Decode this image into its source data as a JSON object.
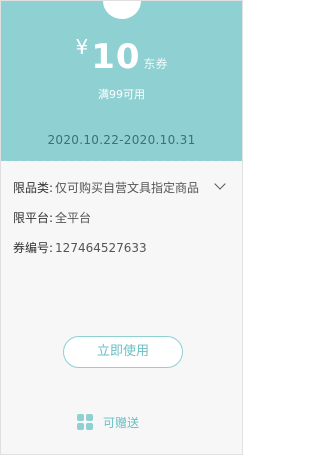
{
  "coupon": {
    "currency": "¥",
    "amount": "10",
    "unit": "东券",
    "condition": "满99可用",
    "validity": "2020.10.22-2020.10.31"
  },
  "details": {
    "category_label": "限品类:",
    "category_value": "仅可购买自营文具指定商品",
    "platform_label": "限平台:",
    "platform_value": "全平台",
    "number_label": "券编号:",
    "number_value": "127464527633"
  },
  "actions": {
    "use_label": "立即使用",
    "gift_label": "可赠送"
  },
  "colors": {
    "accent": "#8fd0d3",
    "accent_text": "#69bfc4"
  },
  "icons": {
    "expand": "chevron-down-icon",
    "gift": "grid-icon"
  }
}
